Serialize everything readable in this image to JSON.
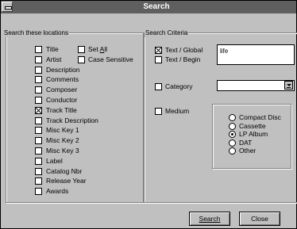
{
  "window": {
    "title": "Search"
  },
  "locations": {
    "group_label": "Search these locations",
    "fields": [
      {
        "label": "Title",
        "checked": false
      },
      {
        "label": "Artist",
        "checked": false
      },
      {
        "label": "Description",
        "checked": false
      },
      {
        "label": "Comments",
        "checked": false
      },
      {
        "label": "Composer",
        "checked": false
      },
      {
        "label": "Conductor",
        "checked": false
      },
      {
        "label": "Track Title",
        "checked": true
      },
      {
        "label": "Track Description",
        "checked": false
      },
      {
        "label": "Misc Key 1",
        "checked": false
      },
      {
        "label": "Misc Key 2",
        "checked": false
      },
      {
        "label": "Misc Key 3",
        "checked": false
      },
      {
        "label": "Label",
        "checked": false
      },
      {
        "label": "Catalog Nbr",
        "checked": false
      },
      {
        "label": "Release Year",
        "checked": false
      },
      {
        "label": "Awards",
        "checked": false
      }
    ],
    "set_all_label": "Set All",
    "set_all_checked": false,
    "case_sensitive_label": "Case Sensitive",
    "case_sensitive_checked": false
  },
  "criteria": {
    "group_label": "Search Criteria",
    "text_global_label": "Text / Global",
    "text_global_checked": true,
    "text_begin_label": "Text / Begin",
    "text_begin_checked": false,
    "text_value": "life",
    "category_label": "Category",
    "category_checked": false,
    "category_value": "",
    "medium_label": "Medium",
    "medium_checked": false,
    "medium_options": [
      {
        "label": "Compact Disc",
        "selected": false
      },
      {
        "label": "Cassette",
        "selected": false
      },
      {
        "label": "LP Album",
        "selected": true
      },
      {
        "label": "DAT",
        "selected": false
      },
      {
        "label": "Other",
        "selected": false
      }
    ]
  },
  "buttons": {
    "search": "Search",
    "close": "Close"
  }
}
